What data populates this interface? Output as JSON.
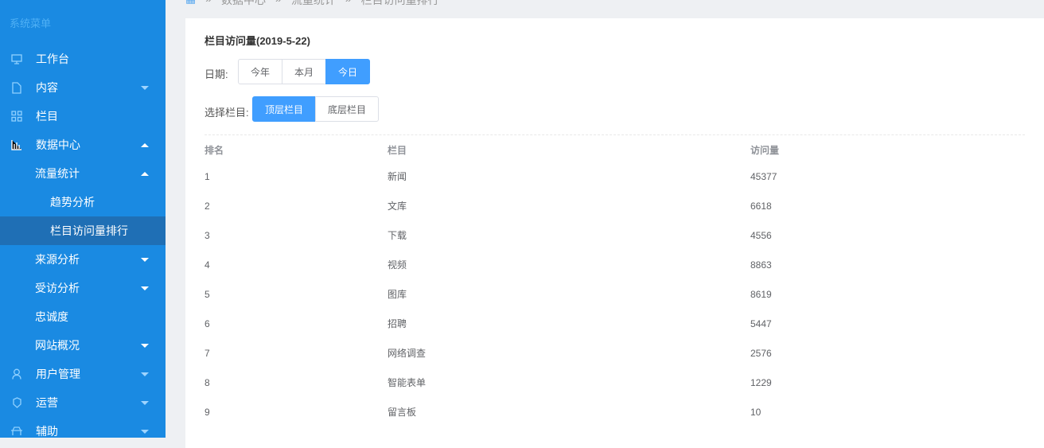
{
  "sidebar": {
    "title": "系统菜单",
    "items": [
      {
        "label": "工作台",
        "icon": "monitor-icon"
      },
      {
        "label": "内容",
        "icon": "file-icon"
      },
      {
        "label": "栏目",
        "icon": "grid-icon"
      },
      {
        "label": "数据中心",
        "icon": "bar-chart-icon"
      },
      {
        "label": "流量统计"
      },
      {
        "label": "趋势分析"
      },
      {
        "label": "栏目访问量排行"
      },
      {
        "label": "来源分析"
      },
      {
        "label": "受访分析"
      },
      {
        "label": "忠诚度"
      },
      {
        "label": "网站概况"
      },
      {
        "label": "用户管理",
        "icon": "user-icon"
      },
      {
        "label": "运营",
        "icon": "shield-icon"
      },
      {
        "label": "辅助",
        "icon": "tool-icon"
      }
    ]
  },
  "breadcrumb": [
    "数据中心",
    "流量统计",
    "栏目访问量排行"
  ],
  "breadcrumb_sep": "»",
  "card": {
    "title": "栏目访问量(2019-5-22)",
    "date_label": "日期:",
    "date_options": [
      "今年",
      "本月",
      "今日"
    ],
    "column_label": "选择栏目:",
    "column_options": [
      "顶层栏目",
      "底层栏目"
    ]
  },
  "table": {
    "headers": [
      "排名",
      "栏目",
      "访问量"
    ],
    "rows": [
      [
        "1",
        "新闻",
        "45377"
      ],
      [
        "2",
        "文库",
        "6618"
      ],
      [
        "3",
        "下载",
        "4556"
      ],
      [
        "4",
        "视频",
        "8863"
      ],
      [
        "5",
        "图库",
        "8619"
      ],
      [
        "6",
        "招聘",
        "5447"
      ],
      [
        "7",
        "网络调查",
        "2576"
      ],
      [
        "8",
        "智能表单",
        "1229"
      ],
      [
        "9",
        "留言板",
        "10"
      ]
    ]
  },
  "colors": {
    "sidebar": "#1a8ae2",
    "active": "#1f6fb5",
    "primary": "#409eff"
  }
}
